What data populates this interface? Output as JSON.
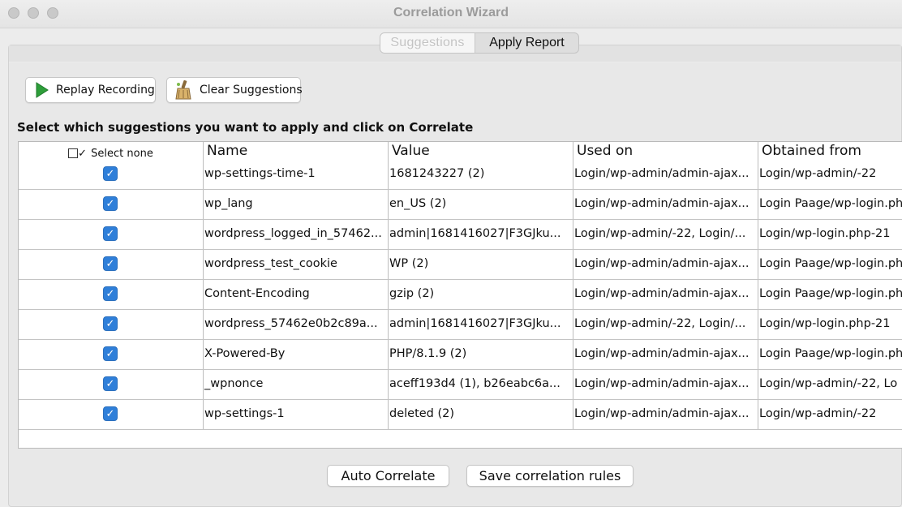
{
  "window": {
    "title": "Correlation Wizard"
  },
  "tabs": [
    {
      "label": "Suggestions",
      "active": true
    },
    {
      "label": "Apply Report",
      "active": false
    }
  ],
  "toolbar": {
    "replay_label": "Replay Recording",
    "clear_label": "Clear Suggestions"
  },
  "instructions": "Select which suggestions you want to apply and click on Correlate",
  "table": {
    "select_header": "Select none",
    "columns": [
      "Name",
      "Value",
      "Used on",
      "Obtained from"
    ],
    "rows": [
      {
        "checked": true,
        "name": "wp-settings-time-1",
        "value": "1681243227 (2)",
        "used_on": "Login/wp-admin/admin-ajax...",
        "obtained_from": "Login/wp-admin/-22"
      },
      {
        "checked": true,
        "name": "wp_lang",
        "value": "en_US (2)",
        "used_on": "Login/wp-admin/admin-ajax...",
        "obtained_from": "Login Paage/wp-login.php"
      },
      {
        "checked": true,
        "name": "wordpress_logged_in_57462...",
        "value": "admin|1681416027|F3GJku...",
        "used_on": "Login/wp-admin/-22, Login/...",
        "obtained_from": "Login/wp-login.php-21"
      },
      {
        "checked": true,
        "name": "wordpress_test_cookie",
        "value": "WP (2)",
        "used_on": "Login/wp-admin/admin-ajax...",
        "obtained_from": "Login Paage/wp-login.php"
      },
      {
        "checked": true,
        "name": "Content-Encoding",
        "value": "gzip (2)",
        "used_on": "Login/wp-admin/admin-ajax...",
        "obtained_from": "Login Paage/wp-login.php"
      },
      {
        "checked": true,
        "name": "wordpress_57462e0b2c89a...",
        "value": "admin|1681416027|F3GJku...",
        "used_on": "Login/wp-admin/-22, Login/...",
        "obtained_from": "Login/wp-login.php-21"
      },
      {
        "checked": true,
        "name": "X-Powered-By",
        "value": "PHP/8.1.9 (2)",
        "used_on": "Login/wp-admin/admin-ajax...",
        "obtained_from": "Login Paage/wp-login.php"
      },
      {
        "checked": true,
        "name": "_wpnonce",
        "value": "aceff193d4 (1), b26eabc6a...",
        "used_on": "Login/wp-admin/admin-ajax...",
        "obtained_from": "Login/wp-admin/-22, Lo"
      },
      {
        "checked": true,
        "name": "wp-settings-1",
        "value": "deleted (2)",
        "used_on": "Login/wp-admin/admin-ajax...",
        "obtained_from": "Login/wp-admin/-22"
      }
    ]
  },
  "footer": {
    "auto_label": "Auto Correlate",
    "save_label": "Save correlation rules"
  },
  "colors": {
    "checkbox": "#2f7fd9",
    "play_icon": "#2e9e3a"
  },
  "icons": {
    "replay": "play-icon",
    "clear": "broom-icon",
    "check": "checkmark-icon"
  }
}
